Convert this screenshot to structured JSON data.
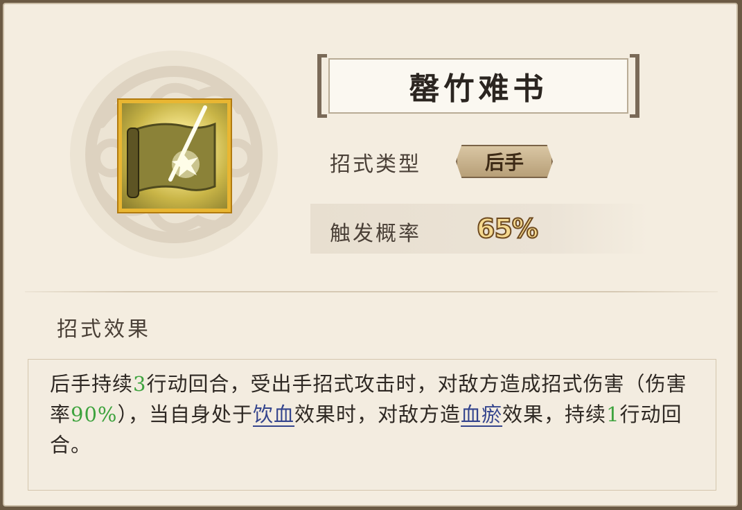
{
  "skill": {
    "name": "罄竹难书",
    "icon": "scroll-strike-icon"
  },
  "stats": {
    "type_label": "招式类型",
    "type_value": "后手",
    "prob_label": "触发概率",
    "prob_value": "65%"
  },
  "effect": {
    "heading": "招式效果",
    "segments": [
      {
        "text": "后手持续",
        "style": "normal"
      },
      {
        "text": "3",
        "style": "green"
      },
      {
        "text": "行动回合，受出手招式攻击时，对敌方造成招式伤害（伤害率",
        "style": "normal"
      },
      {
        "text": "90%",
        "style": "green"
      },
      {
        "text": "），当自身处于",
        "style": "normal"
      },
      {
        "text": "饮血",
        "style": "link"
      },
      {
        "text": "效果时，对敌方造",
        "style": "normal"
      },
      {
        "text": "血瘀",
        "style": "link"
      },
      {
        "text": "效果，持续",
        "style": "normal"
      },
      {
        "text": "1",
        "style": "green"
      },
      {
        "text": "行动回合。",
        "style": "normal"
      }
    ]
  },
  "colors": {
    "highlight_green": "#3ea33e",
    "link_blue": "#34448d",
    "icon_border": "#e9b632"
  }
}
